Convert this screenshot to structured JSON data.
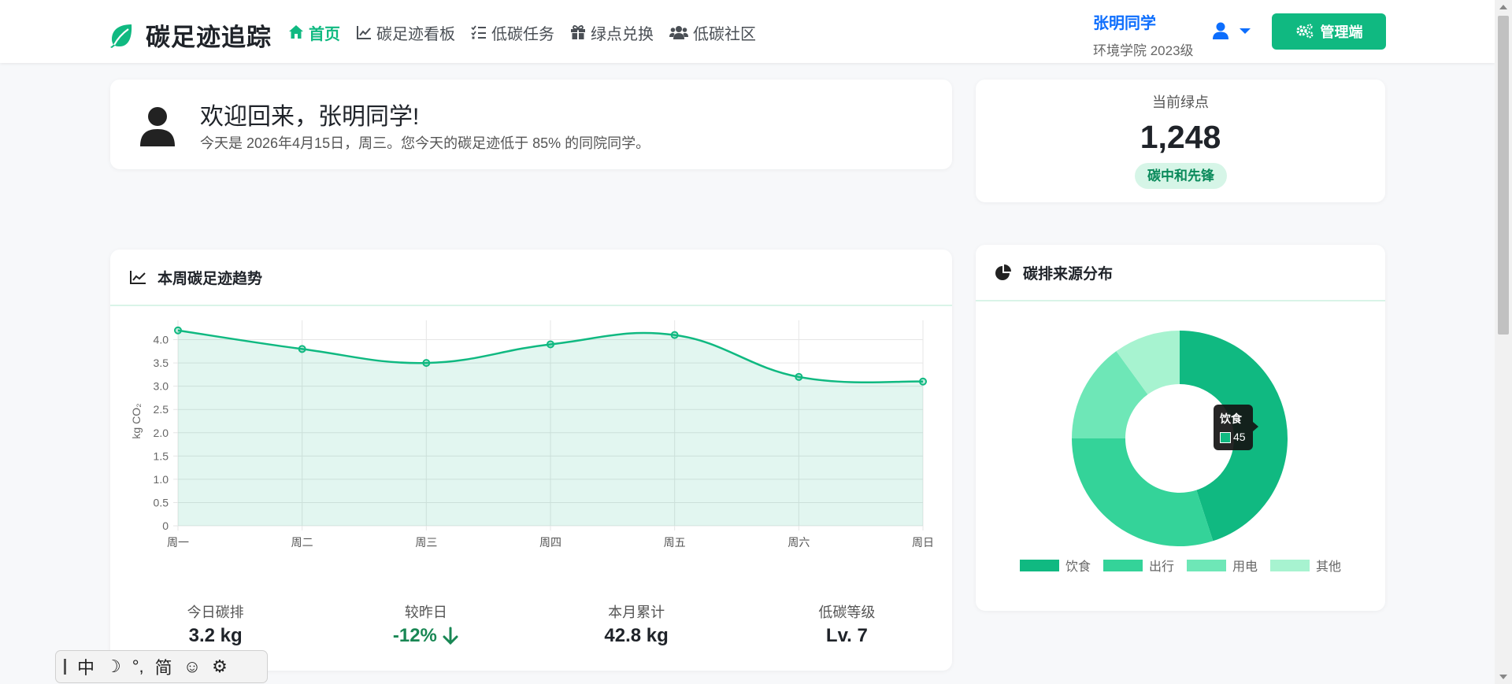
{
  "brand": {
    "name": "碳足迹追踪",
    "icon": "leaf-icon",
    "color": "#10b981"
  },
  "nav": [
    {
      "label": "首页",
      "icon": "home-icon",
      "active": true
    },
    {
      "label": "碳足迹看板",
      "icon": "line-chart-icon"
    },
    {
      "label": "低碳任务",
      "icon": "task-list-icon"
    },
    {
      "label": "绿点兑换",
      "icon": "gift-icon"
    },
    {
      "label": "低碳社区",
      "icon": "users-icon"
    }
  ],
  "user": {
    "name": "张明同学",
    "subtitle": "环境学院 2023级",
    "menu_icon": "user-icon"
  },
  "admin_button": {
    "label": "管理端",
    "icon": "gears-icon"
  },
  "welcome": {
    "title": "欢迎回来，张明同学!",
    "message": "今天是 2026年4月15日，周三。您今天的碳足迹低于 85% 的同院同学。",
    "avatar_icon": "user-avatar-icon"
  },
  "points": {
    "label": "当前绿点",
    "value": "1,248",
    "badge": "碳中和先锋"
  },
  "trend_card": {
    "title": "本周碳足迹趋势",
    "icon": "line-chart-icon",
    "stats": [
      {
        "label": "今日碳排",
        "value": "3.2 kg"
      },
      {
        "label": "较昨日",
        "value": "-12%",
        "trend_icon": "arrow-down-icon",
        "color": "#198754"
      },
      {
        "label": "本月累计",
        "value": "42.8 kg"
      },
      {
        "label": "低碳等级",
        "value": "Lv. 7"
      }
    ]
  },
  "sources_card": {
    "title": "碳排来源分布",
    "icon": "pie-chart-icon",
    "tooltip": {
      "title": "饮食",
      "value": "45"
    }
  },
  "chart_data": [
    {
      "type": "area",
      "categories": [
        "周一",
        "周二",
        "周三",
        "周四",
        "周五",
        "周六",
        "周日"
      ],
      "series": [
        {
          "values": [
            4.2,
            3.8,
            3.5,
            3.9,
            4.1,
            3.2,
            3.1
          ]
        }
      ],
      "ylabel": "kg CO₂",
      "ylim": [
        0,
        4.5
      ],
      "yticks": [
        "0",
        "0.5",
        "1.0",
        "1.5",
        "2.0",
        "2.5",
        "3.0",
        "3.5",
        "4.0",
        "4.5"
      ],
      "grid": true,
      "color": "#10b981"
    },
    {
      "type": "pie",
      "donut": true,
      "categories": [
        "饮食",
        "出行",
        "用电",
        "其他"
      ],
      "values": [
        45,
        30,
        15,
        10
      ],
      "colors": [
        "#10b981",
        "#34d399",
        "#6ee7b7",
        "#a7f3d0"
      ],
      "legend": "bottom"
    }
  ],
  "ime": {
    "mode": "中",
    "moon": "☽",
    "punct": "°,",
    "charset": "简",
    "emoji": "☺",
    "settings": "⚙"
  }
}
